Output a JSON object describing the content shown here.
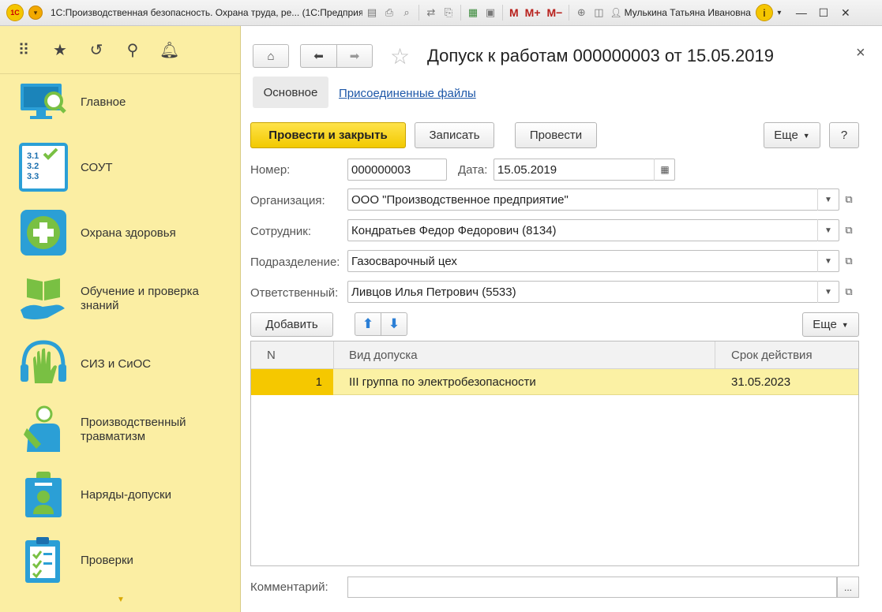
{
  "window": {
    "title": "1С:Производственная безопасность. Охрана труда, ре...  (1С:Предприятие)",
    "user": "Мулькина Татьяна Ивановна",
    "toolbar_m": [
      "M",
      "M+",
      "M−"
    ]
  },
  "sidebar": {
    "items": [
      {
        "label": "Главное",
        "icon": "monitor-search-icon"
      },
      {
        "label": "СОУТ",
        "icon": "checklist-numbers-icon"
      },
      {
        "label": "Охрана здоровья",
        "icon": "medical-cross-icon"
      },
      {
        "label": "Обучение и проверка знаний",
        "icon": "book-hand-icon"
      },
      {
        "label": "СИЗ и СиОС",
        "icon": "glove-headphones-icon"
      },
      {
        "label": "Производственный травматизм",
        "icon": "injured-person-icon"
      },
      {
        "label": "Наряды-допуски",
        "icon": "badge-person-icon"
      },
      {
        "label": "Проверки",
        "icon": "clipboard-check-icon"
      }
    ]
  },
  "document": {
    "title": "Допуск к работам 000000003 от 15.05.2019",
    "tabs": [
      "Основное",
      "Присоединенные файлы"
    ]
  },
  "commands": {
    "post_close": "Провести и закрыть",
    "save": "Записать",
    "post": "Провести",
    "more": "Еще",
    "help": "?"
  },
  "form": {
    "number_label": "Номер:",
    "number": "000000003",
    "date_label": "Дата:",
    "date": "15.05.2019",
    "org_label": "Организация:",
    "org": "ООО \"Производственное предприятие\"",
    "employee_label": "Сотрудник:",
    "employee": "Кондратьев Федор Федорович (8134)",
    "dept_label": "Подразделение:",
    "dept": "Газосварочный цех",
    "resp_label": "Ответственный:",
    "resp": "Ливцов Илья Петрович (5533)"
  },
  "table": {
    "add": "Добавить",
    "more": "Еще",
    "columns": [
      "N",
      "Вид допуска",
      "Срок действия"
    ],
    "rows": [
      {
        "n": "1",
        "kind": "III группа по электробезопасности",
        "valid": "31.05.2023"
      }
    ]
  },
  "comment": {
    "label": "Комментарий:",
    "value": "",
    "button": "..."
  }
}
